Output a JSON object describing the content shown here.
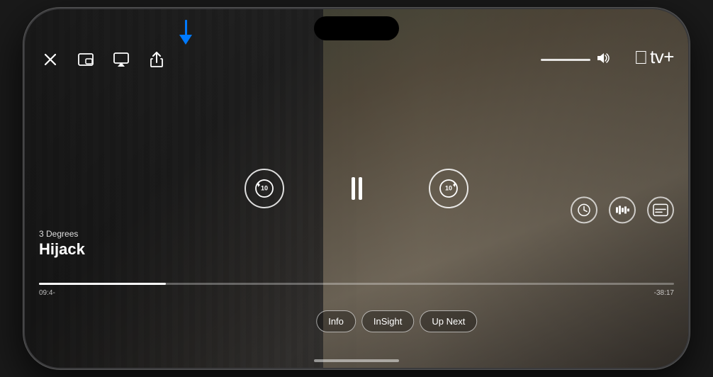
{
  "phone": {
    "title": "iPhone"
  },
  "show": {
    "subtitle": "3 Degrees",
    "title": "Hijack"
  },
  "apple_tv": {
    "logo": "tv+",
    "apple_symbol": ""
  },
  "controls": {
    "rewind_label": "10",
    "forward_label": "10",
    "pause_label": "pause",
    "close_icon": "✕"
  },
  "progress": {
    "current_time": "09:4-",
    "remaining_time": "-38:17",
    "fill_percent": 20
  },
  "tabs": [
    {
      "label": "Info"
    },
    {
      "label": "InSight"
    },
    {
      "label": "Up Next"
    }
  ],
  "top_icons": [
    {
      "name": "close",
      "symbol": "✕"
    },
    {
      "name": "pip",
      "symbol": "⧉"
    },
    {
      "name": "airplay",
      "symbol": "▭"
    },
    {
      "name": "share",
      "symbol": "⬆"
    }
  ],
  "right_icons": [
    {
      "name": "speed",
      "symbol": "◎"
    },
    {
      "name": "audio",
      "symbol": "≋"
    },
    {
      "name": "subtitles",
      "symbol": "⊡"
    }
  ],
  "volume": {
    "icon": "🔊"
  },
  "arrow": {
    "color": "#007AFF"
  }
}
